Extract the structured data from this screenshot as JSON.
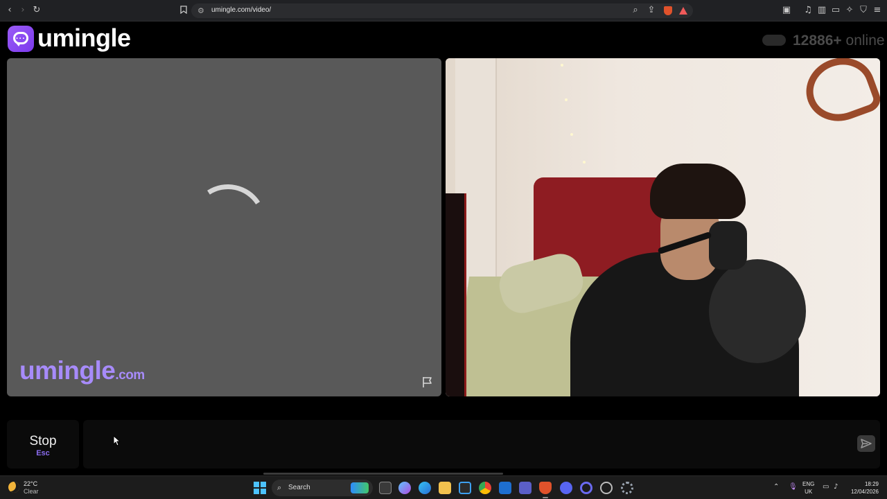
{
  "browser": {
    "url": "umingle.com/video/"
  },
  "site": {
    "logo_text": "umingle",
    "online_count": "12886+",
    "online_suffix": "online"
  },
  "stranger_panel": {
    "watermark_name": "umingle",
    "watermark_domain": ".com",
    "loading": true
  },
  "controls": {
    "stop_label": "Stop",
    "stop_shortcut": "Esc",
    "chat_placeholder": "",
    "send_icon": "send-icon"
  },
  "taskbar": {
    "weather_temp": "22°C",
    "weather_condition": "Clear",
    "search_label": "Search",
    "language_line1": "ENG",
    "language_line2": "UK",
    "time": "18:29",
    "date": "12/04/2026"
  },
  "colors": {
    "brand": "#8b5cf6",
    "brand_light": "#a78bfa",
    "panel_bg": "#595959"
  }
}
